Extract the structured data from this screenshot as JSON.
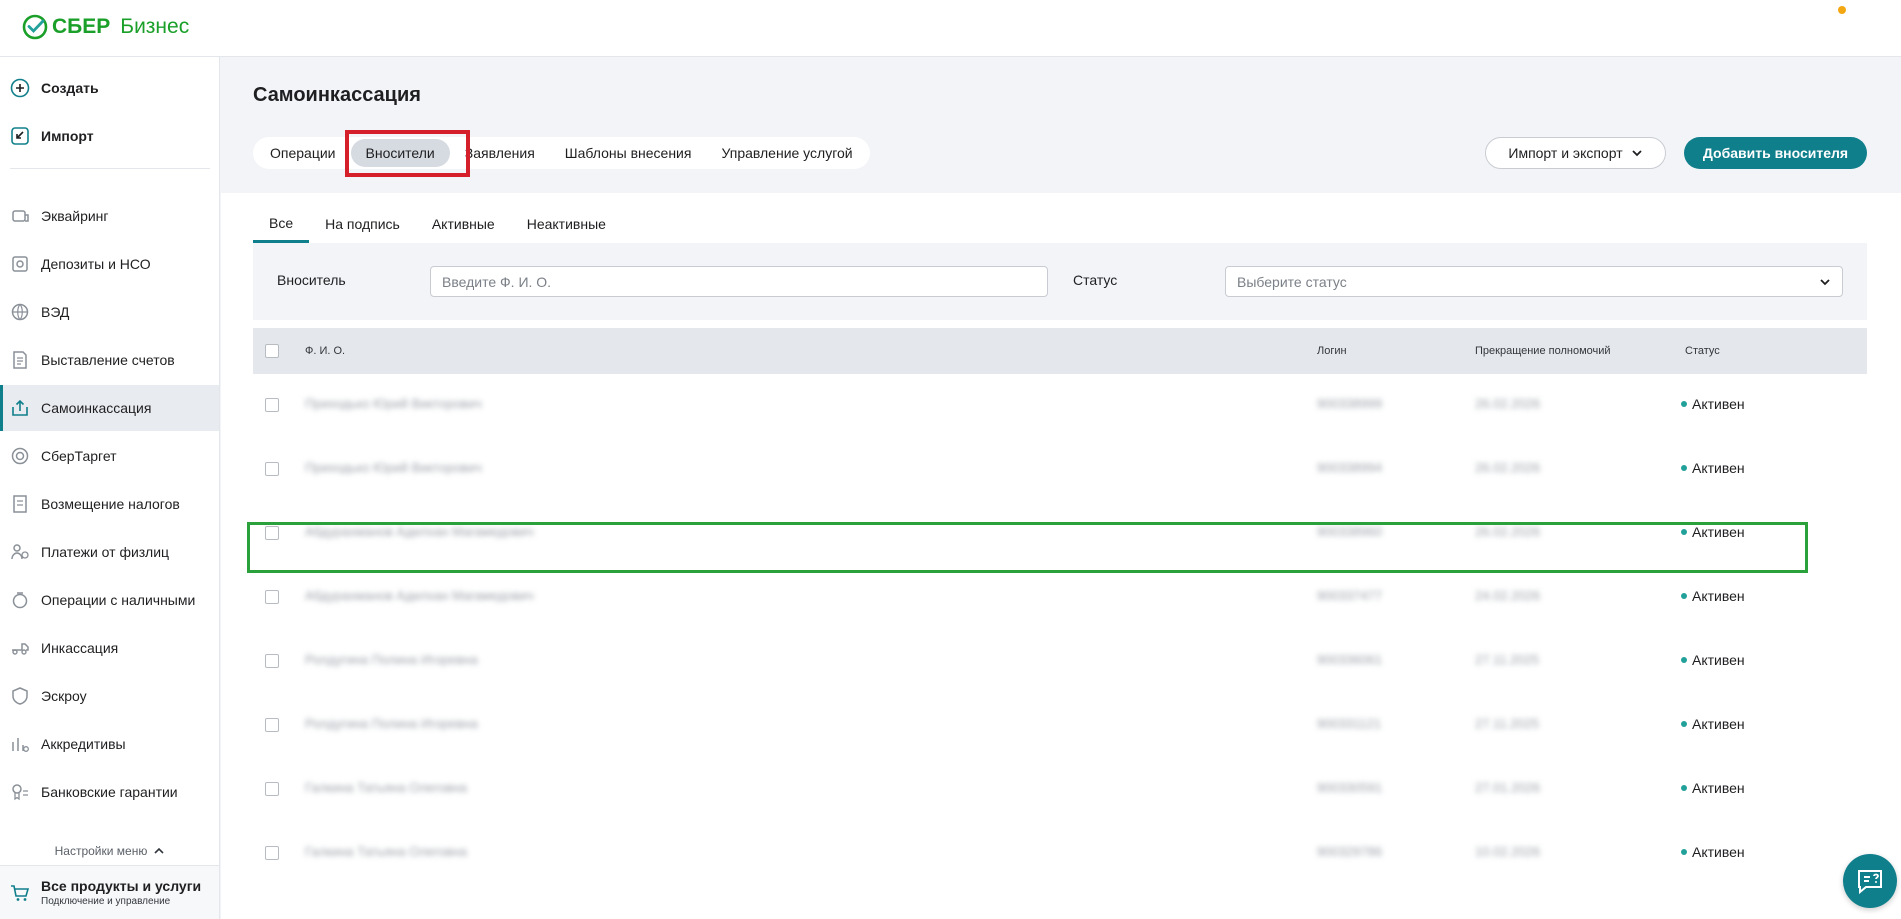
{
  "header": {
    "brand_name": "СБЕР",
    "brand_suffix": "Бизнес",
    "colors": {
      "brand": "#1a9f29",
      "accent": "#107f8c",
      "notification": "#f3a712"
    }
  },
  "sidebar": {
    "create_label": "Создать",
    "import_label": "Импорт",
    "items": [
      {
        "label": "Эквайринг",
        "icon": "acquiring-icon"
      },
      {
        "label": "Депозиты и НСО",
        "icon": "deposit-icon"
      },
      {
        "label": "ВЭД",
        "icon": "globe-icon"
      },
      {
        "label": "Выставление счетов",
        "icon": "invoice-icon"
      },
      {
        "label": "Самоинкассация",
        "icon": "self-collection-icon"
      },
      {
        "label": "СберТаргет",
        "icon": "target-icon"
      },
      {
        "label": "Возмещение налогов",
        "icon": "tax-refund-icon"
      },
      {
        "label": "Платежи от физлиц",
        "icon": "person-payments-icon"
      },
      {
        "label": "Операции с наличными",
        "icon": "cash-icon"
      },
      {
        "label": "Инкассация",
        "icon": "collection-icon"
      },
      {
        "label": "Эскроу",
        "icon": "shield-icon"
      },
      {
        "label": "Аккредитивы",
        "icon": "letter-of-credit-icon"
      },
      {
        "label": "Банковские гарантии",
        "icon": "guarantee-icon"
      }
    ],
    "active_item": "Самоинкассация",
    "menu_settings_label": "Настройки меню",
    "all_products_title": "Все продукты и услуги",
    "all_products_subtitle": "Подключение и управление"
  },
  "page": {
    "title": "Самоинкассация",
    "tabs": [
      "Операции",
      "Вносители",
      "Заявления",
      "Шаблоны внесения",
      "Управление услугой"
    ],
    "selected_tab": "Вносители",
    "import_export_label": "Импорт и экспорт",
    "add_button_label": "Добавить вносителя"
  },
  "subtabs": {
    "items": [
      "Все",
      "На подпись",
      "Активные",
      "Неактивные"
    ],
    "selected": "Все"
  },
  "filters": {
    "depositor_label": "Вноситель",
    "depositor_placeholder": "Введите Ф. И. О.",
    "status_label": "Статус",
    "status_placeholder": "Выберите статус"
  },
  "table": {
    "columns": [
      "Ф. И. О.",
      "Логин",
      "Прекращение полномочий",
      "Статус"
    ],
    "rows": [
      {
        "name": "Приходько Юрий Викторович",
        "login": "900338999",
        "end_date": "26.02.2026",
        "status": "Активен"
      },
      {
        "name": "Приходько Юрий Викторович",
        "login": "900338994",
        "end_date": "26.02.2026",
        "status": "Активен"
      },
      {
        "name": "Абдурахманов Адилхан Магамедович",
        "login": "900338960",
        "end_date": "26.02.2026",
        "status": "Активен"
      },
      {
        "name": "Абдурахманов Адилхан Магамедович",
        "login": "900337477",
        "end_date": "24.02.2026",
        "status": "Активен"
      },
      {
        "name": "Ролдугина Полина Игоревна",
        "login": "900336061",
        "end_date": "27.11.2025",
        "status": "Активен"
      },
      {
        "name": "Ролдугина Полина Игоревна",
        "login": "900331121",
        "end_date": "27.11.2025",
        "status": "Активен"
      },
      {
        "name": "Галкина Татьяна Олеговна",
        "login": "900330591",
        "end_date": "27.01.2026",
        "status": "Активен"
      },
      {
        "name": "Галкина Татьяна Олеговна",
        "login": "900329786",
        "end_date": "10.02.2026",
        "status": "Активен"
      }
    ]
  }
}
